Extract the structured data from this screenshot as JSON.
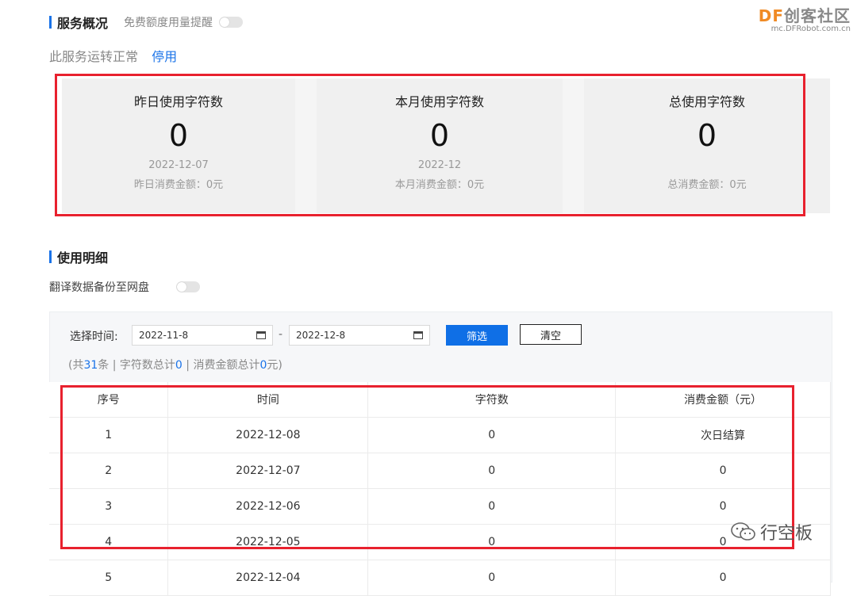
{
  "overview": {
    "title": "服务概况",
    "free_quota_reminder_label": "免费额度用量提醒",
    "status_text": "此服务运转正常",
    "disable_link": "停用"
  },
  "stats": [
    {
      "title": "昨日使用字符数",
      "value": "0",
      "date": "2022-12-07",
      "cost": "昨日消费金额：0元"
    },
    {
      "title": "本月使用字符数",
      "value": "0",
      "date": "2022-12",
      "cost": "本月消费金额：0元"
    },
    {
      "title": "总使用字符数",
      "value": "0",
      "date": "",
      "cost": "总消费金额：0元"
    }
  ],
  "detail": {
    "title": "使用明细",
    "backup_label": "翻译数据备份至网盘"
  },
  "filter": {
    "time_label": "选择时间:",
    "start_date": "2022-11-8",
    "separator": "-",
    "end_date": "2022-12-8",
    "filter_button": "筛选",
    "clear_button": "清空",
    "summary_prefix": "(共",
    "total_count": "31",
    "summary_mid1": "条 | 字符数总计",
    "total_chars": "0",
    "summary_mid2": " | 消费金额总计",
    "total_cost": "0",
    "summary_suffix": "元)"
  },
  "table": {
    "headers": [
      "序号",
      "时间",
      "字符数",
      "消费金额（元）"
    ],
    "rows": [
      [
        "1",
        "2022-12-08",
        "0",
        "次日结算"
      ],
      [
        "2",
        "2022-12-07",
        "0",
        "0"
      ],
      [
        "3",
        "2022-12-06",
        "0",
        "0"
      ],
      [
        "4",
        "2022-12-05",
        "0",
        "0"
      ],
      [
        "5",
        "2022-12-04",
        "0",
        "0"
      ]
    ]
  },
  "watermark": {
    "brand_df": "DF",
    "brand_rest": "创客社区",
    "url": "mc.DFRobot.com.cn",
    "wechat_name": "行空板"
  },
  "colors": {
    "accent": "#1a73e8",
    "highlight_border": "#e8212e"
  }
}
